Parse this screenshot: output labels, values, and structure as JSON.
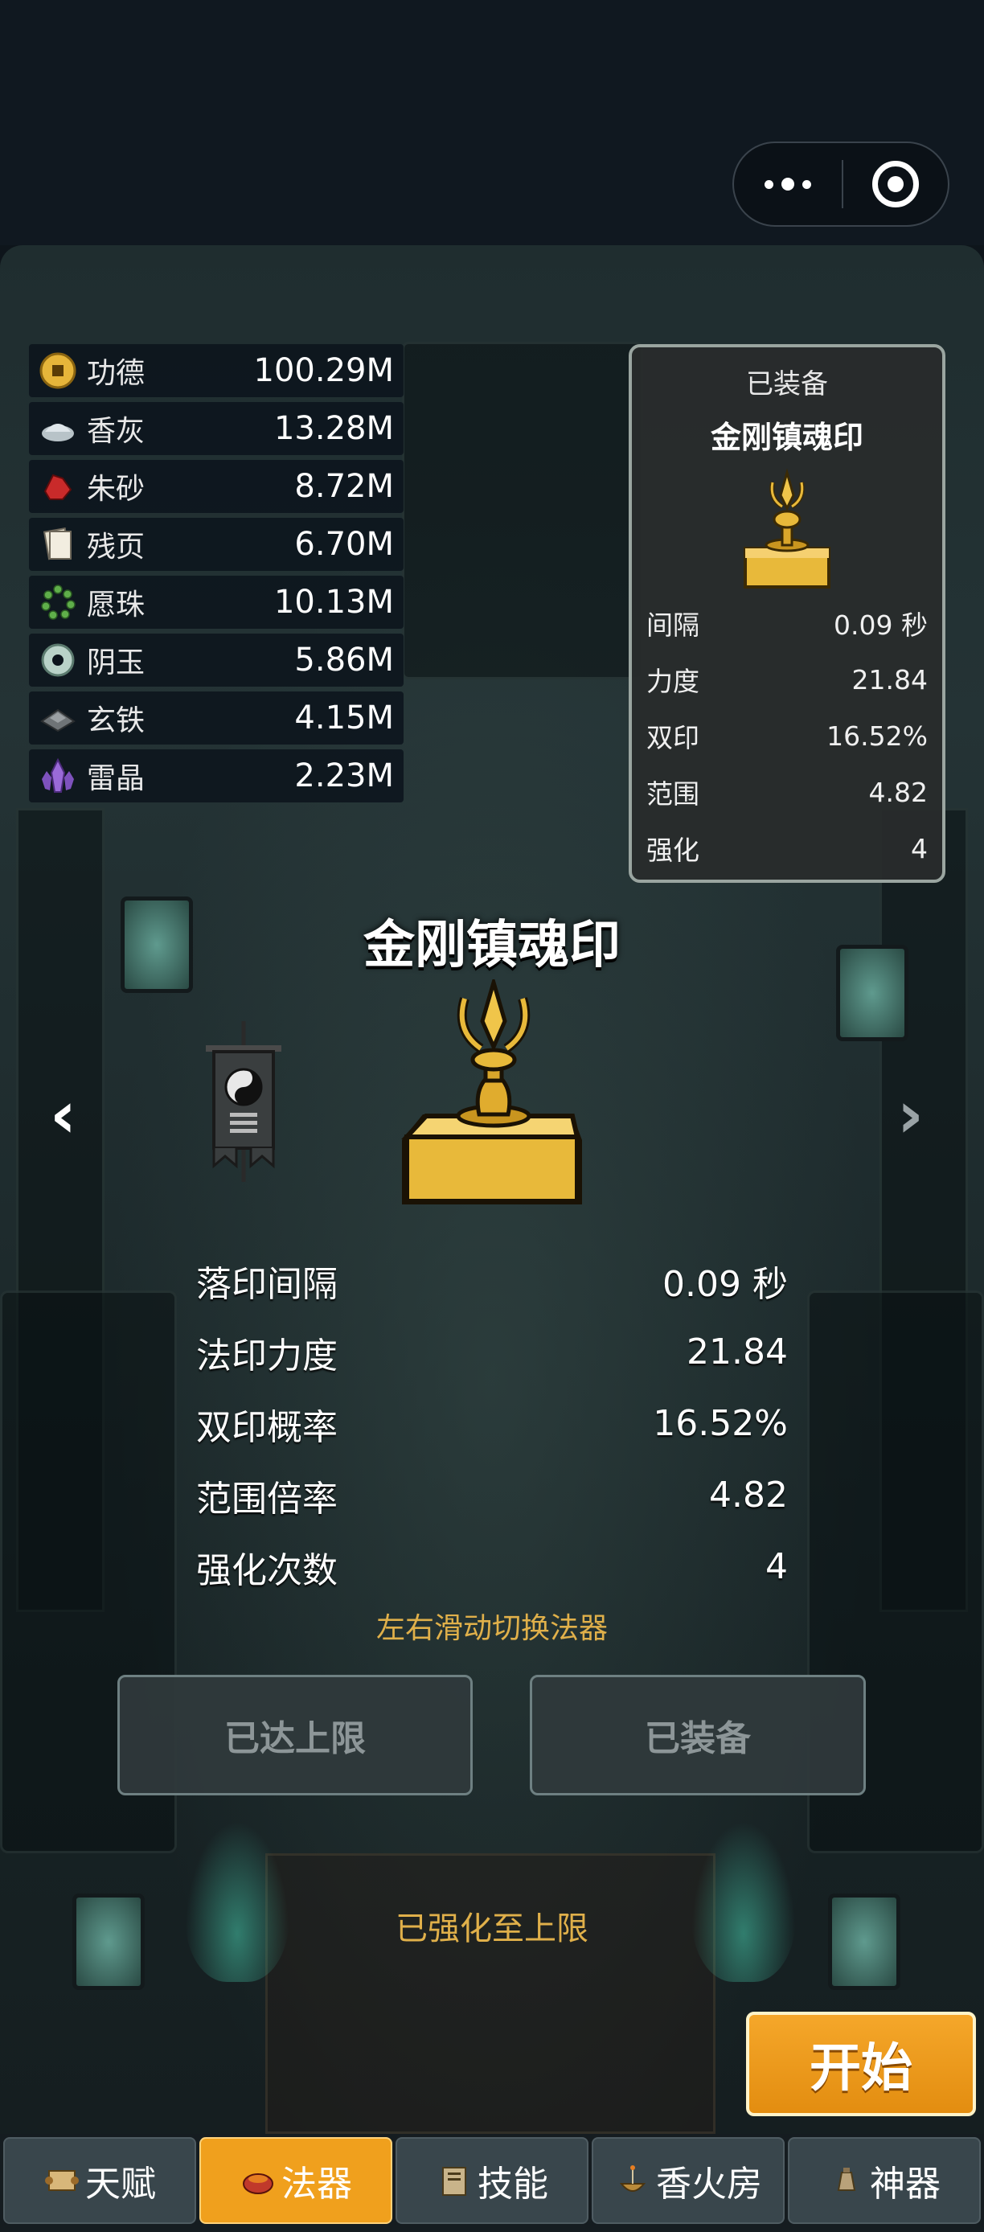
{
  "resources": [
    {
      "icon": "coin-icon",
      "name": "功德",
      "value": "100.29M"
    },
    {
      "icon": "incense-ash-icon",
      "name": "香灰",
      "value": "13.28M"
    },
    {
      "icon": "cinnabar-icon",
      "name": "朱砂",
      "value": "8.72M"
    },
    {
      "icon": "scroll-pages-icon",
      "name": "残页",
      "value": "6.70M"
    },
    {
      "icon": "prayer-beads-icon",
      "name": "愿珠",
      "value": "10.13M"
    },
    {
      "icon": "jade-ring-icon",
      "name": "阴玉",
      "value": "5.86M"
    },
    {
      "icon": "iron-ingot-icon",
      "name": "玄铁",
      "value": "4.15M"
    },
    {
      "icon": "thunder-crystal-icon",
      "name": "雷晶",
      "value": "2.23M"
    }
  ],
  "equipped": {
    "label": "已装备",
    "name": "金刚镇魂印",
    "icon": "vajra-seal-icon",
    "stats": [
      {
        "label": "间隔",
        "value": "0.09 秒"
      },
      {
        "label": "力度",
        "value": "21.84"
      },
      {
        "label": "双印",
        "value": "16.52%"
      },
      {
        "label": "范围",
        "value": "4.82"
      },
      {
        "label": "强化",
        "value": "4"
      }
    ]
  },
  "artifact": {
    "name": "金刚镇魂印",
    "icon": "vajra-seal-icon",
    "prev_arrow": "‹",
    "next_arrow": "›",
    "side_item": "taiji-banner-icon",
    "stats": [
      {
        "label": "落印间隔",
        "value": "0.09 秒"
      },
      {
        "label": "法印力度",
        "value": "21.84"
      },
      {
        "label": "双印概率",
        "value": "16.52%"
      },
      {
        "label": "范围倍率",
        "value": "4.82"
      },
      {
        "label": "强化次数",
        "value": "4"
      }
    ],
    "hint": "左右滑动切换法器"
  },
  "buttons": {
    "max": "已达上限",
    "equipped": "已装备"
  },
  "max_note": "已强化至上限",
  "start_button": "开始",
  "tabs": [
    {
      "icon": "scroll-icon",
      "label": "天赋",
      "active": false
    },
    {
      "icon": "bowl-icon",
      "label": "法器",
      "active": true
    },
    {
      "icon": "book-icon",
      "label": "技能",
      "active": false
    },
    {
      "icon": "incense-burner-icon",
      "label": "香火房",
      "active": false
    },
    {
      "icon": "bell-icon",
      "label": "神器",
      "active": false
    }
  ],
  "colors": {
    "accent": "#f0a01d",
    "hint_gold": "#e0b04a",
    "seal_gold": "#e8b93a"
  }
}
